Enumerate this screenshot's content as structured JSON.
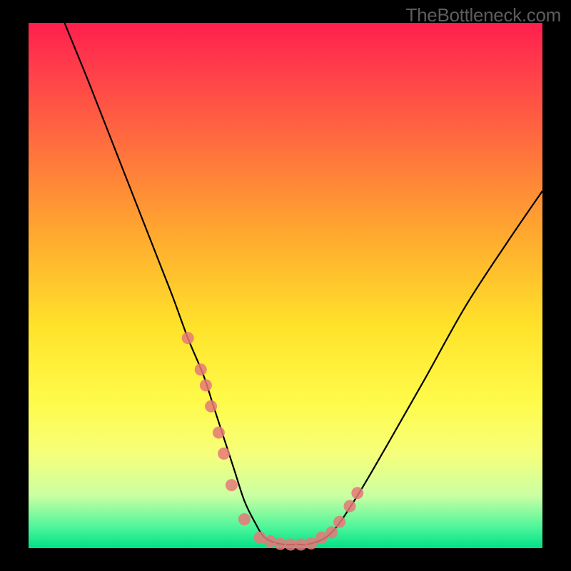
{
  "watermark": "TheBottleneck.com",
  "chart_data": {
    "type": "line",
    "title": "",
    "xlabel": "",
    "ylabel": "",
    "ylim": [
      0,
      100
    ],
    "xlim": [
      0,
      100
    ],
    "x": [
      7,
      12,
      18,
      24,
      28,
      31,
      34,
      36,
      38,
      40,
      42,
      44,
      46,
      49,
      52,
      55,
      59,
      64,
      70,
      77,
      85,
      93,
      100
    ],
    "values": [
      100,
      88,
      73,
      58,
      48,
      40,
      33,
      27,
      21,
      15,
      9,
      5,
      2,
      0.8,
      0.7,
      0.9,
      3,
      10,
      20,
      32,
      46,
      58,
      68
    ],
    "markers": {
      "x": [
        31,
        33.5,
        34.5,
        35.5,
        37,
        38,
        39.5,
        42,
        45,
        47,
        49,
        51,
        53,
        55,
        57,
        59,
        60.5,
        62.5,
        64
      ],
      "y": [
        40,
        34,
        31,
        27,
        22,
        18,
        12,
        5.5,
        2,
        1.3,
        0.8,
        0.7,
        0.7,
        0.9,
        2,
        3,
        5,
        8,
        10.5
      ]
    },
    "colors": {
      "gradient_top": "#ff1f4d",
      "gradient_bottom": "#00e087",
      "curve": "#000000",
      "marker": "#e37676"
    }
  }
}
